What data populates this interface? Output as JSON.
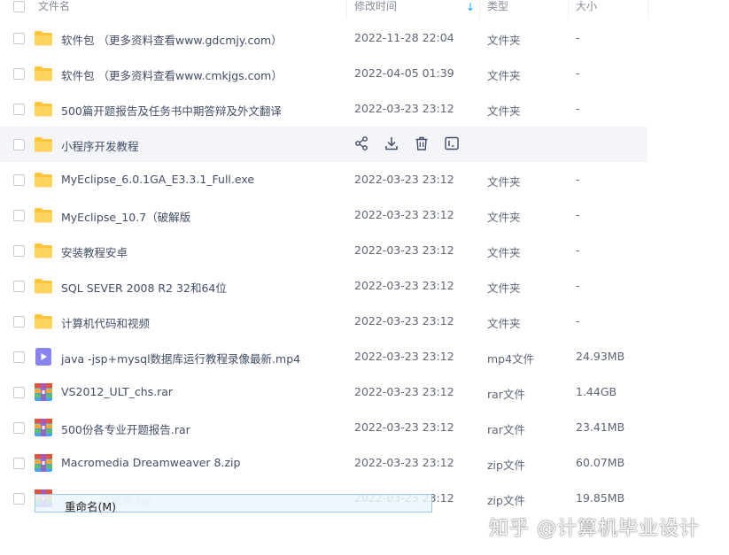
{
  "header": {
    "col_name": "文件名",
    "col_modified": "修改时间",
    "col_type": "类型",
    "col_size": "大小"
  },
  "rows": [
    {
      "name": "软件包 （更多资料查看www.gdcmjy.com）",
      "date": "2022-11-28 22:04",
      "type": "文件夹",
      "size": "-",
      "icon": "folder-icon"
    },
    {
      "name": "软件包 （更多资料查看www.cmkjgs.com）",
      "date": "2022-04-05 01:39",
      "type": "文件夹",
      "size": "-",
      "icon": "folder-icon"
    },
    {
      "name": "500篇开题报告及任务书中期答辩及外文翻译",
      "date": "2022-03-23 23:12",
      "type": "文件夹",
      "size": "-",
      "icon": "folder-icon"
    },
    {
      "name": "小程序开发教程",
      "date": "",
      "type": "",
      "size": "",
      "icon": "folder-icon"
    },
    {
      "name": "MyEclipse_6.0.1GA_E3.3.1_Full.exe",
      "date": "2022-03-23 23:12",
      "type": "文件夹",
      "size": "-",
      "icon": "folder-icon"
    },
    {
      "name": "MyEclipse_10.7（破解版",
      "date": "2022-03-23 23:12",
      "type": "文件夹",
      "size": "-",
      "icon": "folder-icon"
    },
    {
      "name": "安装教程安卓",
      "date": "2022-03-23 23:12",
      "type": "文件夹",
      "size": "-",
      "icon": "folder-icon"
    },
    {
      "name": "SQL SEVER 2008 R2  32和64位",
      "date": "2022-03-23 23:12",
      "type": "文件夹",
      "size": "-",
      "icon": "folder-icon"
    },
    {
      "name": "计算机代码和视频",
      "date": "2022-03-23 23:12",
      "type": "文件夹",
      "size": "-",
      "icon": "folder-icon"
    },
    {
      "name": "java -jsp+mysql数据库运行教程录像最新.mp4",
      "date": "2022-03-23 23:12",
      "type": "mp4文件",
      "size": "24.93MB",
      "icon": "video-file-icon"
    },
    {
      "name": "VS2012_ULT_chs.rar",
      "date": "2022-03-23 23:12",
      "type": "rar文件",
      "size": "1.44GB",
      "icon": "archive-icon"
    },
    {
      "name": "500份各专业开题报告.rar",
      "date": "2022-03-23 23:12",
      "type": "rar文件",
      "size": "23.41MB",
      "icon": "archive-icon"
    },
    {
      "name": "Macromedia Dreamweaver 8.zip",
      "date": "2022-03-23 23:12",
      "type": "zip文件",
      "size": "60.07MB",
      "icon": "archive-icon"
    },
    {
      "name": "...数据库.zip",
      "date": "2022-03-23 23:12",
      "type": "zip文件",
      "size": "19.85MB",
      "icon": "archive-icon"
    }
  ],
  "hover_actions": [
    "share-icon",
    "download-icon",
    "delete-icon",
    "rename-icon"
  ],
  "context_menu": {
    "item": "重命名(M)"
  },
  "watermark": "知乎 @计算机毕业设计",
  "colors": {
    "folder": "#ffc53d",
    "accent": "#06a7ff",
    "hover_row": "#f4f5f9"
  }
}
